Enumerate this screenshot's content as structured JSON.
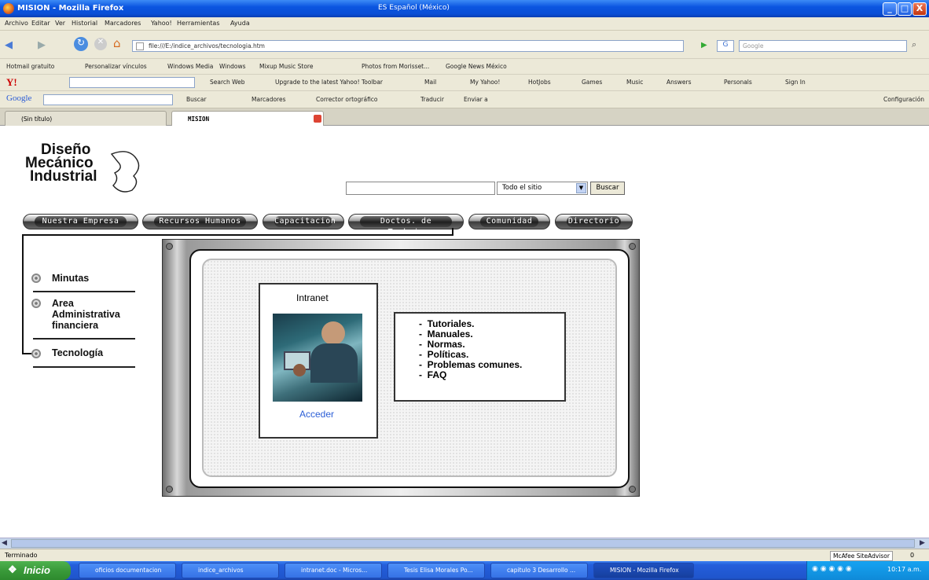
{
  "window": {
    "title": "MISION - Mozilla Firefox",
    "language": "ES Español (México)",
    "min": "_",
    "max": "□",
    "close": "X"
  },
  "menu": [
    "Archivo",
    "Editar",
    "Ver",
    "Historial",
    "Marcadores",
    "Yahoo!",
    "Herramientas",
    "Ayuda"
  ],
  "nav": {
    "url": "file:///E:/indice_archivos/tecnologia.htm",
    "search_placeholder": "Google"
  },
  "bookmarks": [
    "Hotmail gratuito",
    "Personalizar vínculos",
    "Windows Media",
    "Windows",
    "Mixup Music Store",
    "Photos from Morisset...",
    "Google News México"
  ],
  "yahoo": {
    "logo": "Y!",
    "items": [
      "Search Web",
      "Upgrade to the latest Yahoo! Toolbar",
      "Mail",
      "My Yahoo!",
      "HotJobs",
      "Games",
      "Music",
      "Answers",
      "Personals",
      "Sign In"
    ]
  },
  "googlebar": {
    "logo": "Google",
    "items": [
      "Buscar",
      "Marcadores",
      "Corrector ortográfico",
      "Traducir",
      "Enviar a"
    ],
    "settings": "Configuración"
  },
  "tabs": [
    {
      "label": "(Sin título)"
    },
    {
      "label": "MISION"
    }
  ],
  "site": {
    "logo": [
      "Diseño",
      "Mecánico",
      "Industrial"
    ],
    "search": {
      "scope": "Todo el sitio",
      "button": "Buscar"
    },
    "nav": [
      "Nuestra Empresa",
      "Recursos Humanos",
      "Capacitacion",
      "Doctos. de Trabajo",
      "Comunidad",
      "Directorio"
    ],
    "side": [
      "Minutas",
      "Area Administrativa financiera",
      "Tecnología"
    ],
    "intranet": {
      "title": "Intranet",
      "link": "Acceder"
    },
    "list": [
      "Tutoriales.",
      "Manuales.",
      "Normas.",
      "Políticas.",
      "Problemas comunes.",
      "FAQ"
    ]
  },
  "status": {
    "text": "Terminado",
    "siteadvisor": "McAfee SiteAdvisor",
    "count": "0"
  },
  "taskbar": {
    "start": "Inicio",
    "tasks": [
      "oficios documentacion",
      "indice_archivos",
      "intranet.doc - Micros...",
      "Tesis Elisa Morales Po...",
      "capitulo 3 Desarrollo ...",
      "MISION - Mozilla Firefox"
    ],
    "clock": "10:17 a.m."
  },
  "colors": {
    "titlebar": "#0b55e0",
    "link": "#2b5ed6",
    "chrome": "#ece9d8"
  }
}
